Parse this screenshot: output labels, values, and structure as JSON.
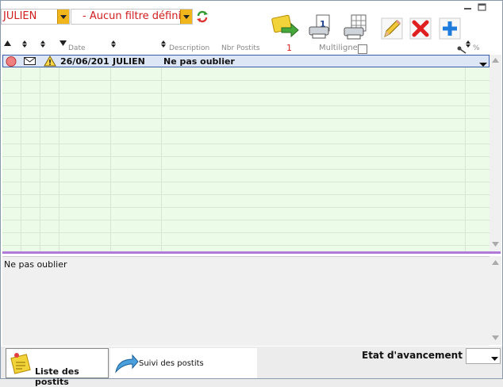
{
  "filters": {
    "user": "JULIEN",
    "filter": "- Aucun filtre défini"
  },
  "columns": {
    "date": "Date",
    "description": "Description",
    "nbr_postits": "Nbr Postits",
    "nbr_value": "1",
    "multiligne": "Multiligne",
    "percent": "%"
  },
  "row": {
    "date": "26/06/201",
    "user": "JULIEN",
    "description": "Ne pas oublier"
  },
  "memo": {
    "text": "Ne pas oublier"
  },
  "tabs": {
    "liste": "Liste des postits",
    "suivi": "Suivi des postits"
  },
  "status": {
    "label": "Etat d'avancement"
  },
  "colors": {
    "accent": "#f1b61c",
    "filter_text": "#d21d1d",
    "row_bg": "#ecfbe8",
    "selection_border": "#3b5ca8",
    "separator": "#b07ad8"
  }
}
